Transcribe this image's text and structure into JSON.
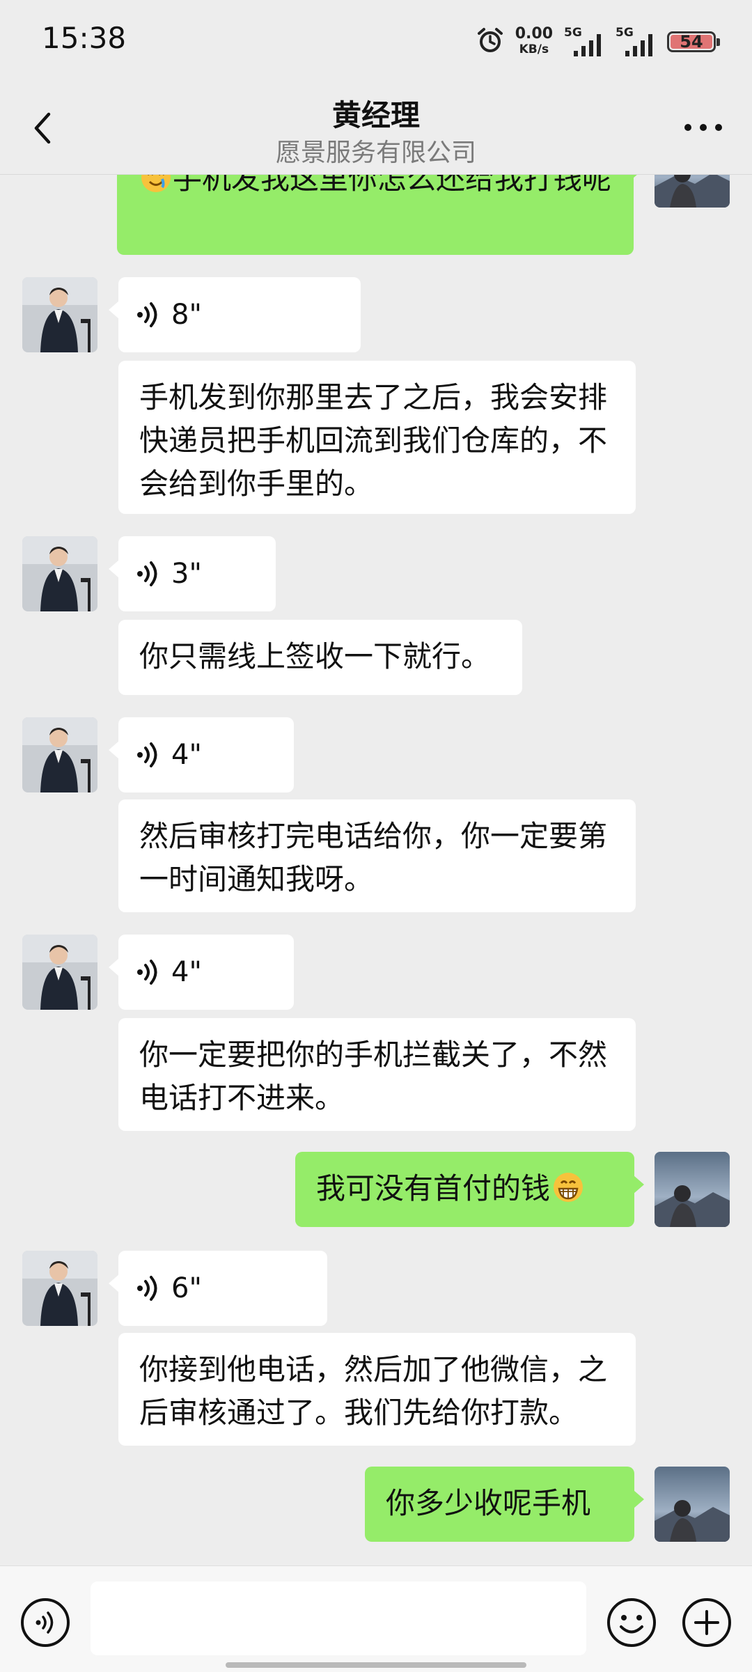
{
  "status_bar": {
    "time": "15:38",
    "net_speed": "0.00",
    "net_unit": "KB/s",
    "sim1": "5G",
    "sim2": "5G",
    "battery": "54"
  },
  "header": {
    "title": "黄经理",
    "subtitle": "愿景服务有限公司"
  },
  "messages": [
    {
      "side": "out",
      "type": "text",
      "text": "手机发我这里你怎么还给我打钱呢",
      "emoji_prefix": "face-icon"
    },
    {
      "side": "in",
      "type": "voice",
      "duration": "8\""
    },
    {
      "side": "in",
      "type": "text",
      "text": "手机发到你那里去了之后，我会安排快递员把手机回流到我们仓库的，不会给到你手里的。"
    },
    {
      "side": "in",
      "type": "voice",
      "duration": "3\""
    },
    {
      "side": "in",
      "type": "text",
      "text": "你只需线上签收一下就行。"
    },
    {
      "side": "in",
      "type": "voice",
      "duration": "4\""
    },
    {
      "side": "in",
      "type": "text",
      "text": "然后审核打完电话给你，你一定要第一时间通知我呀。"
    },
    {
      "side": "in",
      "type": "voice",
      "duration": "4\""
    },
    {
      "side": "in",
      "type": "text",
      "text": "你一定要把你的手机拦截关了，不然电话打不进来。"
    },
    {
      "side": "out",
      "type": "text",
      "text": "我可没有首付的钱",
      "emoji_suffix": "grin-icon"
    },
    {
      "side": "in",
      "type": "voice",
      "duration": "6\""
    },
    {
      "side": "in",
      "type": "text",
      "text": "你接到他电话，然后加了他微信，之后审核通过了。我们先给你打款。"
    },
    {
      "side": "out",
      "type": "text",
      "text": "你多少收呢手机"
    }
  ],
  "colors": {
    "background": "#ededed",
    "bubble_out": "#95ec69",
    "bubble_in": "#ffffff",
    "input_bar": "#f7f7f7"
  }
}
